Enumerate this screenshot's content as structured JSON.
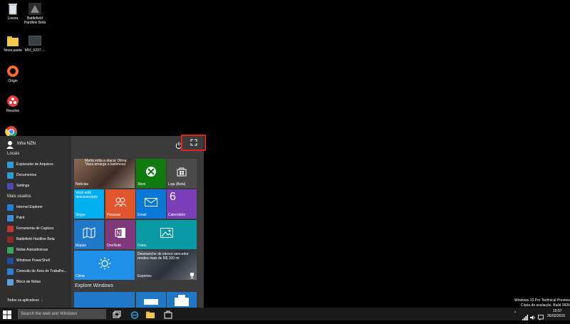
{
  "desktop": {
    "icons": [
      {
        "label": "Lixeira",
        "icon": "recycle-bin-icon"
      },
      {
        "label": "Battlefield Hardline Beta",
        "icon": "battlefield-icon"
      },
      {
        "label": "Nova pasta",
        "icon": "folder-icon"
      },
      {
        "label": "MVI_0237....",
        "icon": "video-file-icon"
      },
      {
        "label": "Origin",
        "icon": "origin-icon"
      },
      {
        "label": "Resolve",
        "icon": "resolve-icon"
      }
    ]
  },
  "start_menu": {
    "user_name": "Infra NZN",
    "sections": {
      "places": "Locais",
      "most_used": "Mais usados",
      "all_apps": "Todos os aplicativos"
    },
    "places": [
      {
        "label": "Explorador de Arquivos",
        "color": "#2d9bd8"
      },
      {
        "label": "Documentos",
        "color": "#2d9bd8"
      },
      {
        "label": "Settings",
        "color": "#4b4bb5"
      }
    ],
    "most_used": [
      {
        "label": "Internet Explorer",
        "color": "#1e7fd6"
      },
      {
        "label": "Paint",
        "color": "#3a8fd8"
      },
      {
        "label": "Ferramenta de Captura",
        "color": "#c8352c"
      },
      {
        "label": "Battlefield Hardline Beta",
        "color": "#8c2a2a"
      },
      {
        "label": "Notas Autoadesivas",
        "color": "#3aa55c"
      },
      {
        "label": "Windows PowerShell",
        "color": "#1f4f9c"
      },
      {
        "label": "Conexão de Área de Trabalho...",
        "color": "#2a7fd0"
      },
      {
        "label": "Bloco de Notas",
        "color": "#5ea0d8"
      }
    ],
    "tiles": {
      "news": {
        "label": "Notícias",
        "headline": "Marta volta a atacar Dilma: 'Vaca amarga a lastimosa'"
      },
      "xbox": {
        "label": "Xbox"
      },
      "store": {
        "label": "Loja (Beta)"
      },
      "skype": {
        "label": "Skype",
        "status": "Você está desconectado"
      },
      "people": {
        "label": "Pessoas"
      },
      "mail": {
        "label": "Email"
      },
      "calendar": {
        "label": "Calendário",
        "day": "6"
      },
      "maps": {
        "label": "Mapas"
      },
      "onenote": {
        "label": "OneNote"
      },
      "photos": {
        "label": "Fotos"
      },
      "weather": {
        "label": "Clima"
      },
      "sports": {
        "label": "Esportes",
        "headline": "Desmanche de elenco vencedor rendeu mais de R$ 100 mi"
      }
    },
    "explore_label": "Explore Windows"
  },
  "taskbar": {
    "search_placeholder": "Search the web and Windows",
    "time": "15:57",
    "date": "26/02/2015"
  },
  "watermark": {
    "line1": "Windows 10 Pro Technical Preview",
    "line2": "Cópia de avaliação. Build 9926"
  }
}
